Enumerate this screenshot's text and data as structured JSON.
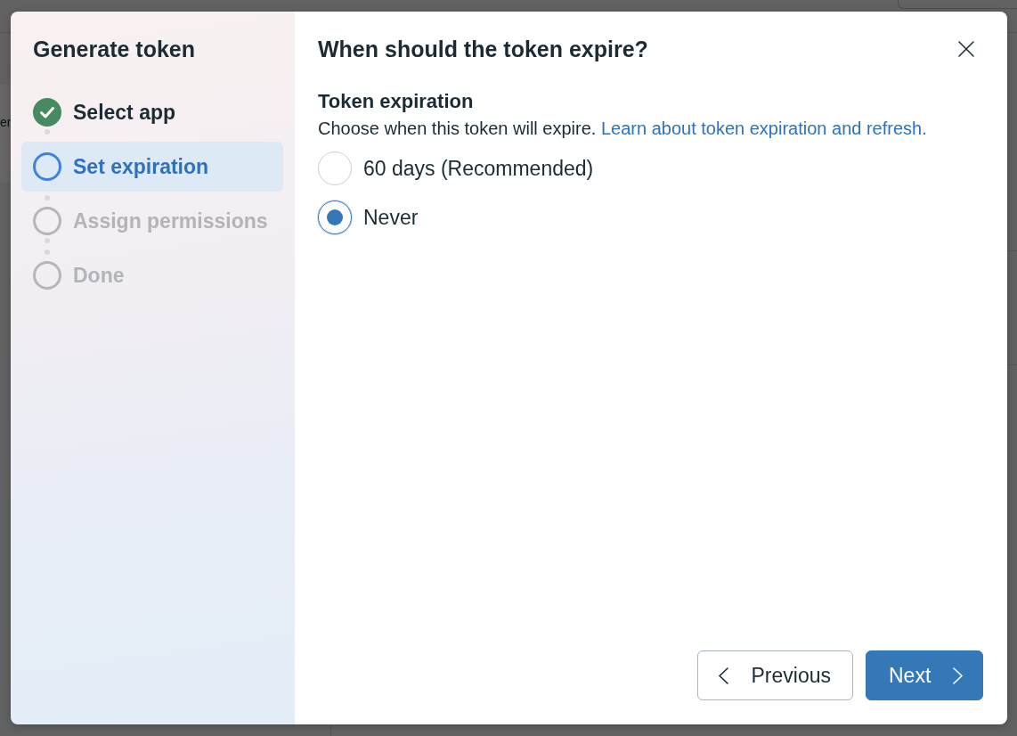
{
  "page_behind": {
    "sidebar_item": "er"
  },
  "dialog": {
    "sidebar": {
      "title": "Generate token",
      "steps": [
        {
          "label": "Select app",
          "completed": true,
          "selected": false
        },
        {
          "label": "Set expiration",
          "completed": false,
          "selected": true
        },
        {
          "label": "Assign permissions",
          "completed": false,
          "selected": false
        },
        {
          "label": "Done",
          "completed": false,
          "selected": false
        }
      ]
    },
    "title": "When should the token expire?",
    "section": {
      "title": "Token expiration",
      "description": "Choose when this token will expire.",
      "link": "Learn about token expiration and refresh."
    },
    "options": [
      {
        "label": "60 days (Recommended)",
        "selected": false
      },
      {
        "label": "Never",
        "selected": true
      }
    ],
    "buttons": [
      {
        "label": "Previous",
        "kind": "secondary"
      },
      {
        "label": "Next",
        "kind": "primary"
      }
    ]
  }
}
